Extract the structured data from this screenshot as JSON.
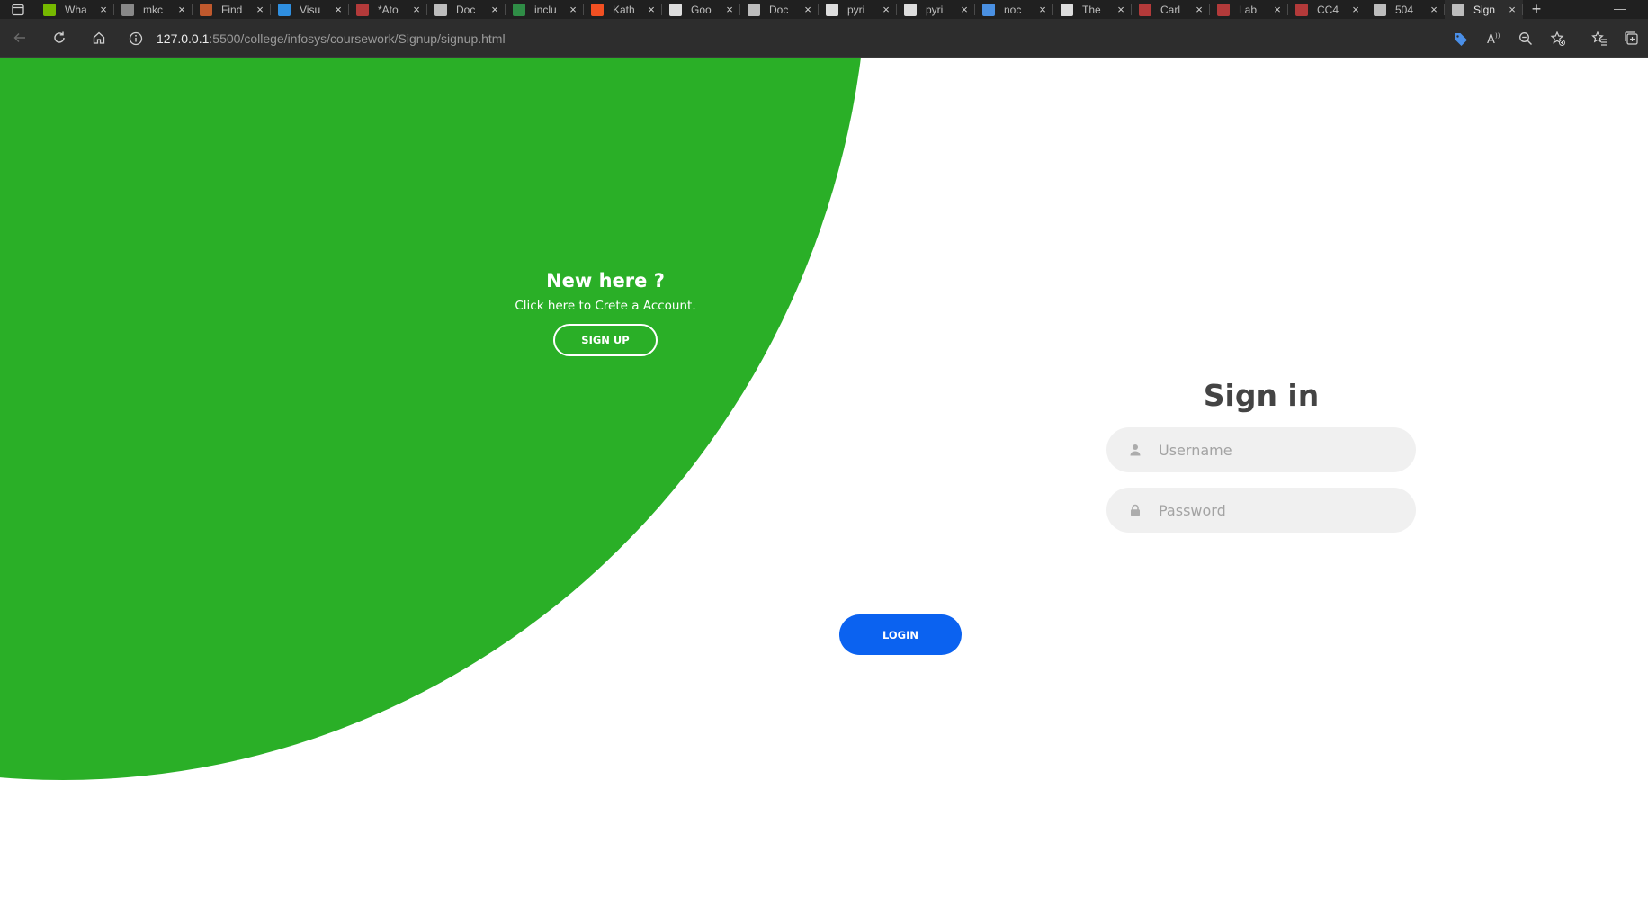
{
  "browser": {
    "tabs": [
      {
        "title": "Wha",
        "icon": "nvidia-icon",
        "color": "#76b900"
      },
      {
        "title": "mkc",
        "icon": "image-icon",
        "color": "#888888"
      },
      {
        "title": "Find",
        "icon": "java-icon",
        "color": "#c0592d"
      },
      {
        "title": "Visu",
        "icon": "vscode-icon",
        "color": "#2f8fe0"
      },
      {
        "title": "*Ato",
        "icon": "pdf-icon",
        "color": "#b33a3a"
      },
      {
        "title": "Doc",
        "icon": "page-icon",
        "color": "#bdbdbd"
      },
      {
        "title": "inclu",
        "icon": "gfg-icon",
        "color": "#2f8d46"
      },
      {
        "title": "Kath",
        "icon": "microsoft-icon",
        "color": "#f25022"
      },
      {
        "title": "Goo",
        "icon": "google-icon",
        "color": "#dddddd"
      },
      {
        "title": "Doc",
        "icon": "page-icon",
        "color": "#bdbdbd"
      },
      {
        "title": "pyri",
        "icon": "github-icon",
        "color": "#dddddd"
      },
      {
        "title": "pyri",
        "icon": "github-icon",
        "color": "#dddddd"
      },
      {
        "title": "noc",
        "icon": "search-icon",
        "color": "#4a90e2"
      },
      {
        "title": "The",
        "icon": "a-icon",
        "color": "#dddddd"
      },
      {
        "title": "Carl",
        "icon": "pdf-icon",
        "color": "#b33a3a"
      },
      {
        "title": "Lab",
        "icon": "pdf-icon",
        "color": "#b33a3a"
      },
      {
        "title": "CC4",
        "icon": "pdf-icon",
        "color": "#b33a3a"
      },
      {
        "title": "504",
        "icon": "page-icon",
        "color": "#bdbdbd"
      },
      {
        "title": "Sign",
        "icon": "page-icon",
        "color": "#bdbdbd",
        "active": true
      }
    ],
    "url_host": "127.0.0.1",
    "url_rest": ":5500/college/infosys/coursework/Signup/signup.html"
  },
  "page": {
    "left_panel": {
      "heading": "New here ?",
      "text": "Click here to Crete a Account.",
      "signup_label": "SIGN UP"
    },
    "signin": {
      "title": "Sign in",
      "username_placeholder": "Username",
      "password_placeholder": "Password",
      "login_label": "LOGIN"
    },
    "colors": {
      "accent_green": "#2aaf27",
      "login_blue": "#0b62f0",
      "title_gray": "#444444"
    }
  }
}
